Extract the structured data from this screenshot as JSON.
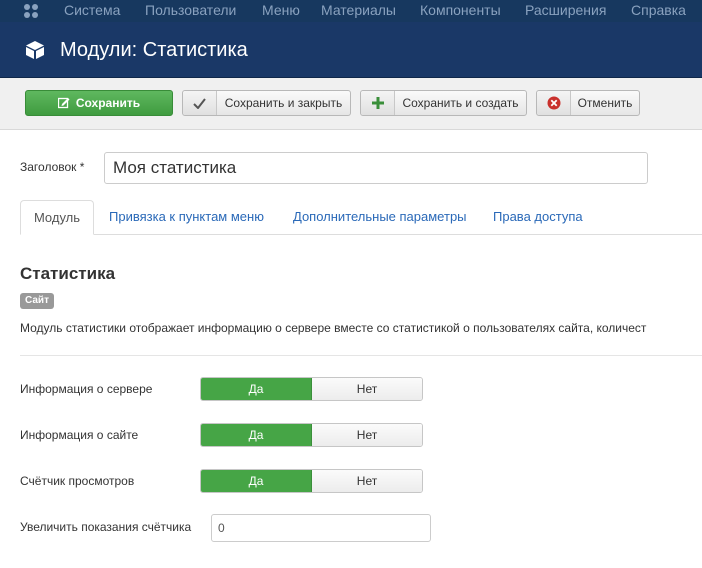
{
  "topnav": {
    "items": [
      "Система",
      "Пользователи",
      "Меню",
      "Материалы",
      "Компоненты",
      "Расширения",
      "Справка"
    ]
  },
  "header": {
    "title": "Модули: Статистика"
  },
  "toolbar": {
    "save": "Сохранить",
    "save_close": "Сохранить и закрыть",
    "save_new": "Сохранить и создать",
    "cancel": "Отменить"
  },
  "form": {
    "title_label": "Заголовок *",
    "title_value": "Моя статистика"
  },
  "tabs": [
    "Модуль",
    "Привязка к пунктам меню",
    "Дополнительные параметры",
    "Права доступа"
  ],
  "module": {
    "heading": "Статистика",
    "badge": "Сайт",
    "description": "Модуль статистики отображает информацию о сервере вместе со статистикой о пользователях сайта, количест"
  },
  "options": [
    {
      "label": "Информация о сервере",
      "yes": "Да",
      "no": "Нет",
      "selected": "Да"
    },
    {
      "label": "Информация о сайте",
      "yes": "Да",
      "no": "Нет",
      "selected": "Да"
    },
    {
      "label": "Счётчик просмотров",
      "yes": "Да",
      "no": "Нет",
      "selected": "Да"
    }
  ],
  "counter": {
    "label": "Увеличить показания счётчика",
    "value": "0"
  },
  "colors": {
    "nav_bg": "#17385f",
    "header_bg": "#1a3867",
    "success": "#46a546",
    "link": "#2a69b8"
  }
}
